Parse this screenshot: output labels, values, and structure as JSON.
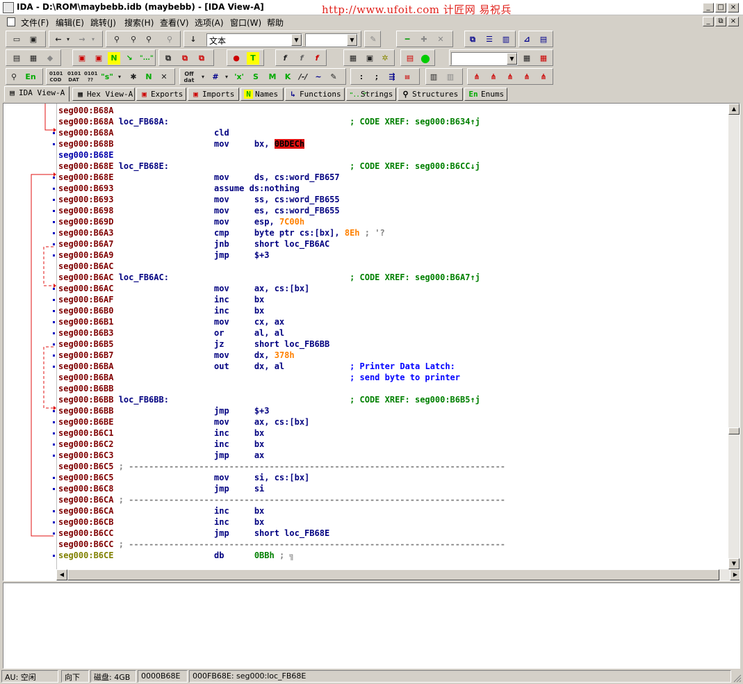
{
  "window": {
    "title": "IDA - D:\\ROM\\maybebb.idb (maybebb) - [IDA View-A]",
    "watermark": "http://www.ufoit.com 计匠网 易祝兵",
    "controls": [
      "_",
      "□",
      "×"
    ],
    "inner_controls": [
      "_",
      "⧉",
      "×"
    ]
  },
  "menu": [
    "文件(F)",
    "编辑(E)",
    "跳转(J)",
    "搜索(H)",
    "查看(V)",
    "选项(A)",
    "窗口(W)",
    "帮助"
  ],
  "toolbar": {
    "mode_combo_value": "文本",
    "second_combo_value": "",
    "third_combo_value": ""
  },
  "tabs": [
    {
      "label": "IDA View-A",
      "icon": "document-icon",
      "active": true
    },
    {
      "label": "Hex View-A",
      "icon": "hex-icon",
      "active": false
    },
    {
      "label": "Exports",
      "icon": "exports-icon",
      "active": false
    },
    {
      "label": "Imports",
      "icon": "imports-icon",
      "active": false
    },
    {
      "label": "Names",
      "icon": "names-icon",
      "active": false
    },
    {
      "label": "Functions",
      "icon": "functions-icon",
      "active": false
    },
    {
      "label": "Strings",
      "icon": "strings-icon",
      "active": false
    },
    {
      "label": "Structures",
      "icon": "structures-icon",
      "active": false
    },
    {
      "label": "Enums",
      "icon": "enums-icon",
      "active": false
    }
  ],
  "disasm": [
    {
      "addr": "seg000:B68A",
      "label": "",
      "mn": "",
      "op": "",
      "cmt": ""
    },
    {
      "addr": "seg000:B68A",
      "label": "loc_FB68A:",
      "mn": "",
      "op": "",
      "cmt": "; CODE XREF: seg000:B634↑j"
    },
    {
      "addr": "seg000:B68A",
      "label": "",
      "mn": "cld",
      "op": "",
      "cmt": ""
    },
    {
      "addr": "seg000:B68B",
      "label": "",
      "mn": "mov",
      "op": "bx, ",
      "opnum": "0BDECh",
      "highlight": true,
      "cmt": ""
    },
    {
      "addr": "seg000:B68E",
      "label": "",
      "mn": "",
      "op": "",
      "cmt": "",
      "addr_color": "blue"
    },
    {
      "addr": "seg000:B68E",
      "label": "loc_FB68E:",
      "mn": "",
      "op": "",
      "cmt": "; CODE XREF: seg000:B6CC↓j"
    },
    {
      "addr": "seg000:B68E",
      "label": "",
      "mn": "mov",
      "op": "ds, cs:word_FB657",
      "cmt": ""
    },
    {
      "addr": "seg000:B693",
      "label": "",
      "mn": "assume ds:nothing",
      "op": "",
      "cmt": ""
    },
    {
      "addr": "seg000:B693",
      "label": "",
      "mn": "mov",
      "op": "ss, cs:word_FB655",
      "cmt": ""
    },
    {
      "addr": "seg000:B698",
      "label": "",
      "mn": "mov",
      "op": "es, cs:word_FB655",
      "cmt": ""
    },
    {
      "addr": "seg000:B69D",
      "label": "",
      "mn": "mov",
      "op": "esp, ",
      "opnum": "7C00h",
      "cmt": ""
    },
    {
      "addr": "seg000:B6A3",
      "label": "",
      "mn": "cmp",
      "op": "byte ptr cs:[bx], ",
      "opnum": "8Eh",
      "tail": " ; '?",
      "cmt": ""
    },
    {
      "addr": "seg000:B6A7",
      "label": "",
      "mn": "jnb",
      "op": "short loc_FB6AC",
      "cmt": ""
    },
    {
      "addr": "seg000:B6A9",
      "label": "",
      "mn": "jmp",
      "op": "$+3",
      "cmt": ""
    },
    {
      "addr": "seg000:B6AC",
      "label": "",
      "mn": "",
      "op": "",
      "cmt": ""
    },
    {
      "addr": "seg000:B6AC",
      "label": "loc_FB6AC:",
      "mn": "",
      "op": "",
      "cmt": "; CODE XREF: seg000:B6A7↑j"
    },
    {
      "addr": "seg000:B6AC",
      "label": "",
      "mn": "mov",
      "op": "ax, cs:[bx]",
      "cmt": ""
    },
    {
      "addr": "seg000:B6AF",
      "label": "",
      "mn": "inc",
      "op": "bx",
      "cmt": ""
    },
    {
      "addr": "seg000:B6B0",
      "label": "",
      "mn": "inc",
      "op": "bx",
      "cmt": ""
    },
    {
      "addr": "seg000:B6B1",
      "label": "",
      "mn": "mov",
      "op": "cx, ax",
      "cmt": ""
    },
    {
      "addr": "seg000:B6B3",
      "label": "",
      "mn": "or",
      "op": "al, al",
      "cmt": ""
    },
    {
      "addr": "seg000:B6B5",
      "label": "",
      "mn": "jz",
      "op": "short loc_FB6BB",
      "cmt": ""
    },
    {
      "addr": "seg000:B6B7",
      "label": "",
      "mn": "mov",
      "op": "dx, ",
      "opnum": "378h",
      "cmt": ""
    },
    {
      "addr": "seg000:B6BA",
      "label": "",
      "mn": "out",
      "op": "dx, al",
      "cmt": "; Printer Data Latch:",
      "cmt_color": "blue"
    },
    {
      "addr": "seg000:B6BA",
      "label": "",
      "mn": "",
      "op": "",
      "cmt": "; send byte to printer",
      "cmt_color": "blue"
    },
    {
      "addr": "seg000:B6BB",
      "label": "",
      "mn": "",
      "op": "",
      "cmt": ""
    },
    {
      "addr": "seg000:B6BB",
      "label": "loc_FB6BB:",
      "mn": "",
      "op": "",
      "cmt": "; CODE XREF: seg000:B6B5↑j"
    },
    {
      "addr": "seg000:B6BB",
      "label": "",
      "mn": "jmp",
      "op": "$+3",
      "cmt": ""
    },
    {
      "addr": "seg000:B6BE",
      "label": "",
      "mn": "mov",
      "op": "ax, cs:[bx]",
      "cmt": ""
    },
    {
      "addr": "seg000:B6C1",
      "label": "",
      "mn": "inc",
      "op": "bx",
      "cmt": ""
    },
    {
      "addr": "seg000:B6C2",
      "label": "",
      "mn": "inc",
      "op": "bx",
      "cmt": ""
    },
    {
      "addr": "seg000:B6C3",
      "label": "",
      "mn": "jmp",
      "op": "ax",
      "cmt": ""
    },
    {
      "addr": "seg000:B6C5",
      "sep": true
    },
    {
      "addr": "seg000:B6C5",
      "label": "",
      "mn": "mov",
      "op": "si, cs:[bx]",
      "cmt": ""
    },
    {
      "addr": "seg000:B6C8",
      "label": "",
      "mn": "jmp",
      "op": "si",
      "cmt": ""
    },
    {
      "addr": "seg000:B6CA",
      "sep": true
    },
    {
      "addr": "seg000:B6CA",
      "label": "",
      "mn": "inc",
      "op": "bx",
      "cmt": ""
    },
    {
      "addr": "seg000:B6CB",
      "label": "",
      "mn": "inc",
      "op": "bx",
      "cmt": ""
    },
    {
      "addr": "seg000:B6CC",
      "label": "",
      "mn": "jmp",
      "op": "short loc_FB68E",
      "cmt": ""
    },
    {
      "addr": "seg000:B6CC",
      "sep": true
    },
    {
      "addr": "seg000:B6CE",
      "label": "",
      "mn": "db",
      "op": "",
      "opdb": "0BBh",
      "tail": " ; ╗",
      "cmt": "",
      "addr_color": "olive"
    }
  ],
  "separator_text": "; ---------------------------------------------------------------------------",
  "status": {
    "au": "AU: 空闲",
    "direction": "向下",
    "disk": "磁盘: 4GB",
    "offset": "0000B68E",
    "location": "000FB68E: seg000:loc_FB68E"
  },
  "colors": {
    "address": "#7f0000",
    "code": "#000080",
    "number": "#ff8000",
    "xref_comment": "#008000",
    "auto_comment": "#0000ff",
    "highlight": "#e01010",
    "arrow": "#e01010"
  }
}
